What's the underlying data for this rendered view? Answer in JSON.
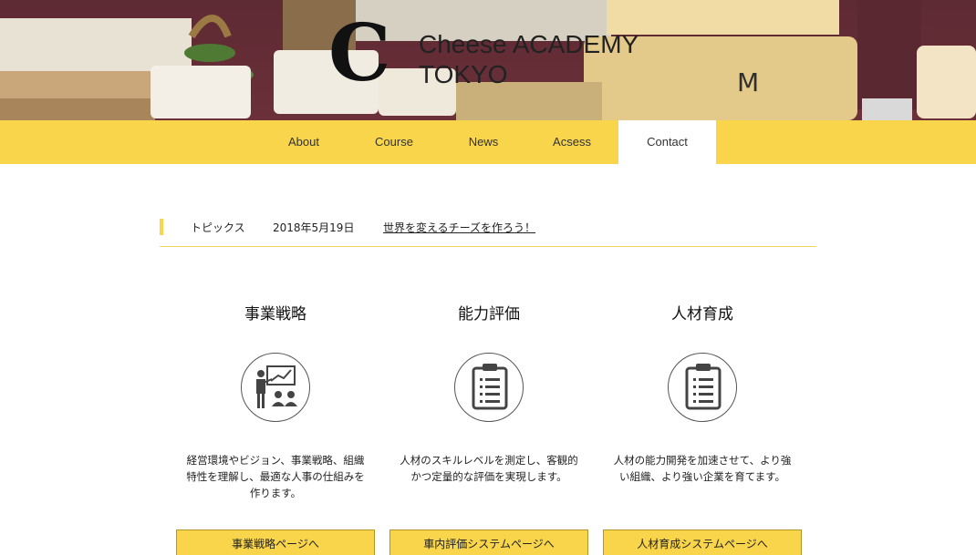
{
  "header": {
    "logo_letter": "C",
    "logo_line1": "Cheese ACADEMY",
    "logo_line2": "TOKYO"
  },
  "nav": {
    "items": [
      {
        "label": "About"
      },
      {
        "label": "Course"
      },
      {
        "label": "News"
      },
      {
        "label": "Acsess"
      },
      {
        "label": "Contact",
        "active": true
      }
    ]
  },
  "topics": {
    "label": "トピックス",
    "date": "2018年5月19日",
    "link_text": "世界を変えるチーズを作ろう！"
  },
  "columns": [
    {
      "title": "事業戦略",
      "icon": "presentation-icon",
      "desc_lines": [
        "経営環境やビジョン、事業戦略、組織",
        "特性を理解し、最適な人事の仕組みを",
        "作ります。"
      ],
      "button": "事業戦略ページへ"
    },
    {
      "title": "能力評価",
      "icon": "clipboard-icon",
      "desc_lines": [
        "人材のスキルレベルを測定し、客観的",
        "かつ定量的な評価を実現します。"
      ],
      "button": "車内評価システムページへ"
    },
    {
      "title": "人材育成",
      "icon": "clipboard-icon",
      "desc_lines": [
        "人材の能力開発を加速させて、より強",
        "い組織、より強い企業を育てます。"
      ],
      "button": "人材育成システムページへ"
    }
  ],
  "colors": {
    "accent": "#f8d54a",
    "hero_background": "#5e2a33"
  }
}
